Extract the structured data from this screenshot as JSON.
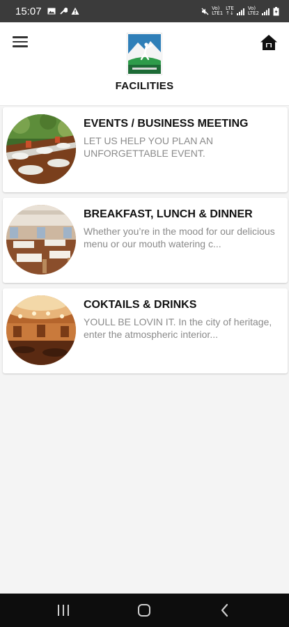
{
  "status_bar": {
    "time": "15:07",
    "left_icons": [
      "image-icon",
      "wrench-icon",
      "warning-icon"
    ],
    "right_icons": [
      "mute-icon",
      "signal-icon",
      "battery-icon"
    ]
  },
  "header": {
    "title": "FACILITIES",
    "logo_icon": "golf-club-logo",
    "menu_icon": "hamburger-icon",
    "home_icon": "home-icon"
  },
  "facilities": [
    {
      "title": "EVENTS / BUSINESS MEETING",
      "description": "LET US HELP YOU PLAN AN UNFORGETTABLE EVENT.",
      "image": "event-table-photo"
    },
    {
      "title": "BREAKFAST, LUNCH & DINNER",
      "description": "Whether you’re in the mood for our delicious menu or our mouth watering c...",
      "image": "dining-room-photo"
    },
    {
      "title": "COKTAILS & DRINKS",
      "description": "YOULL BE LOVIN IT. In the city of heritage, enter the atmospheric interior...",
      "image": "banquet-hall-photo"
    }
  ],
  "nav_bar": {
    "buttons": [
      "recent-apps",
      "home",
      "back"
    ]
  },
  "colors": {
    "status_bar": "#3b3b3b",
    "nav_bar": "#0d0d0d",
    "title_text": "#111111",
    "description_text": "#8a8a8a",
    "page_background": "#f4f4f4"
  }
}
